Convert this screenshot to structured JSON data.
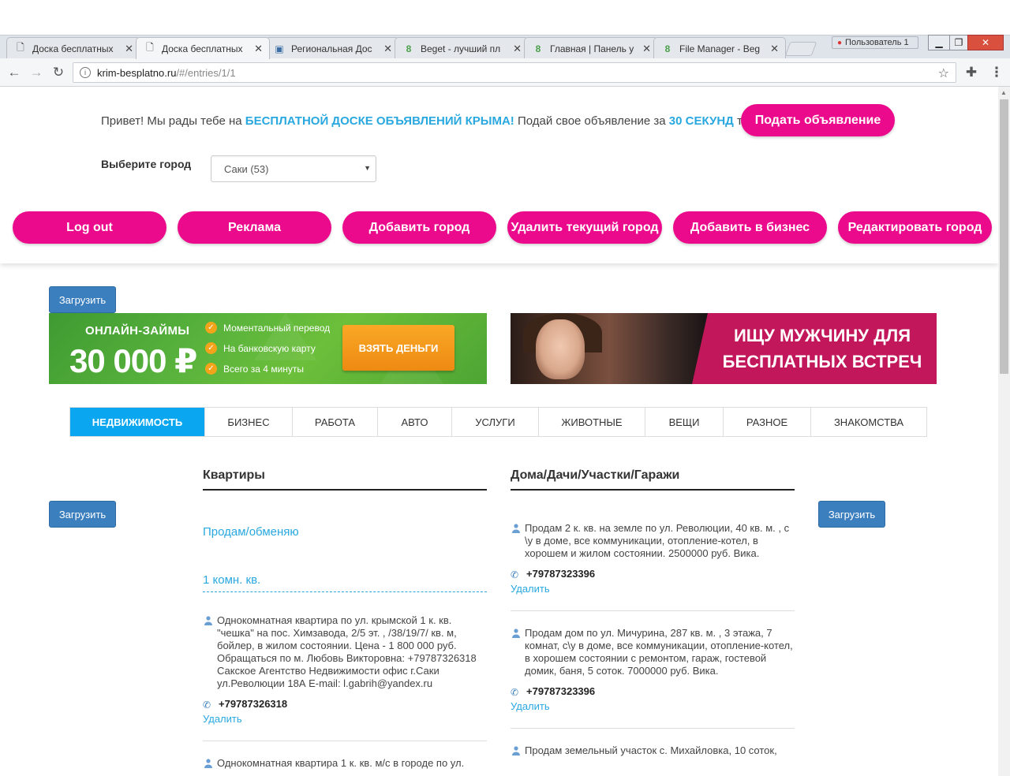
{
  "browser": {
    "tabs": [
      {
        "title": "Доска бесплатных",
        "icon": "page-icon",
        "active": false
      },
      {
        "title": "Доска бесплатных",
        "icon": "page-icon",
        "active": true
      },
      {
        "title": "Региональная Дос",
        "icon": "monitor-icon",
        "active": false
      },
      {
        "title": "Beget - лучший пл",
        "icon": "beget-icon",
        "active": false
      },
      {
        "title": "Главная | Панель у",
        "icon": "beget-icon",
        "active": false
      },
      {
        "title": "File Manager - Beg",
        "icon": "beget-icon",
        "active": false
      }
    ],
    "user_label": "Пользователь 1",
    "url_host": "krim-besplatno.ru",
    "url_path": "/#/entries/1/1"
  },
  "header": {
    "greeting_pre": "Привет! Мы рады тебе на ",
    "greeting_hl1": "БЕСПЛАТНОЙ ДОСКЕ ОБЪЯВЛЕНИЙ КРЫМА!",
    "greeting_mid": " Подай свое объявление за ",
    "greeting_hl2": "30 СЕКУНД",
    "greeting_post": " тут",
    "submit_label": "Подать объявление",
    "city_label": "Выберите город",
    "city_value": "Саки (53)",
    "admin_buttons": [
      "Log out",
      "Реклама",
      "Добавить город",
      "Удалить текущий город",
      "Добавить в бизнес",
      "Редактировать город"
    ]
  },
  "load_label": "Загрузить",
  "banners": {
    "loan": {
      "title": "ОНЛАЙН-ЗАЙМЫ",
      "amount": "30 000 ₽",
      "features": [
        "Моментальный перевод",
        "На банковскую карту",
        "Всего за 4 минуты"
      ],
      "cta": "ВЗЯТЬ ДЕНЬГИ"
    },
    "dating": {
      "line1": "ИЩУ МУЖЧИНУ ДЛЯ",
      "line2": "БЕСПЛАТНЫХ ВСТРЕЧ"
    }
  },
  "categories": [
    "НЕДВИЖИМОСТЬ",
    "БИЗНЕС",
    "РАБОТА",
    "АВТО",
    "УСЛУГИ",
    "ЖИВОТНЫЕ",
    "ВЕЩИ",
    "РАЗНОЕ",
    "ЗНАКОМСТВА"
  ],
  "left_column": {
    "title": "Квартиры",
    "subcat1": "Продам/обменяю",
    "subcat2": "1 комн. кв.",
    "entries": [
      {
        "text": "Однокомнатная квартира по ул. крымской 1 к. кв. \"чешка\" на пос. Химзавода, 2/5 эт. , /38/19/7/ кв. м, бойлер, в жилом состоянии. Цена - 1 800 000 руб. Обращаться по м. Любовь Викторовна: +79787326318 Сакское Агентство Недвижимости офис г.Саки ул.Революции 18А E-mail: l.gabrih@yandex.ru",
        "phone": "+79787326318",
        "delete": "Удалить"
      },
      {
        "text": "Однокомнатная квартира 1 к. кв. м/с в городе по ул."
      }
    ]
  },
  "right_column": {
    "title": "Дома/Дачи/Участки/Гаражи",
    "entries": [
      {
        "text": "Продам 2 к. кв. на земле по ул. Революции, 40 кв. м. , с \\у в доме, все коммуникации, отопление-котел, в хорошем и жилом состоянии. 2500000 руб. Вика.",
        "phone": "+79787323396",
        "delete": "Удалить"
      },
      {
        "text": "Продам дом по ул. Мичурина, 287 кв. м. , 3 этажа, 7 комнат, с\\у в доме, все коммуникации, отопление-котел, в хорошем состоянии с ремонтом, гараж, гостевой домик, баня, 5 соток. 7000000 руб. Вика.",
        "phone": "+79787323396",
        "delete": "Удалить"
      },
      {
        "text": "Продам земельный участок с. Михайловка, 10 соток,"
      }
    ]
  },
  "colors": {
    "accent_pink": "#ec0a8c",
    "accent_blue": "#29a8e0",
    "active_tab": "#0aa7f0",
    "button_blue": "#3c7fbf"
  }
}
